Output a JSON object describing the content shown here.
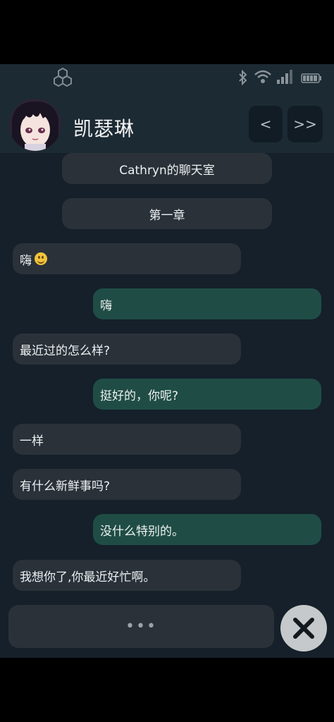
{
  "status_bar": {
    "icons": [
      "hexagon-logo-icon",
      "bluetooth-icon",
      "wifi-icon",
      "signal-icon",
      "battery-icon"
    ]
  },
  "header": {
    "contact_name": "凯瑟琳",
    "prev_label": "<",
    "next_label": ">>"
  },
  "messages": [
    {
      "type": "system",
      "text": "Cathryn的聊天室"
    },
    {
      "type": "system",
      "text": "第一章"
    },
    {
      "type": "incoming",
      "text": "嗨",
      "emoji": "slightly-smiling-face"
    },
    {
      "type": "outgoing",
      "text": "嗨"
    },
    {
      "type": "incoming",
      "text": "最近过的怎么样?"
    },
    {
      "type": "outgoing",
      "text": "挺好的，你呢?"
    },
    {
      "type": "incoming",
      "text": "一样"
    },
    {
      "type": "incoming",
      "text": "有什么新鲜事吗?"
    },
    {
      "type": "outgoing",
      "text": "没什么特别的。"
    },
    {
      "type": "incoming",
      "text": "我想你了,你最近好忙啊。"
    }
  ],
  "composer": {
    "typing_indicator": "•••",
    "close_icon": "close-x-icon"
  },
  "colors": {
    "background": "#15202a",
    "header": "#1c2a33",
    "incoming_bubble": "#2a3139",
    "outgoing_bubble": "#1f4d45"
  }
}
